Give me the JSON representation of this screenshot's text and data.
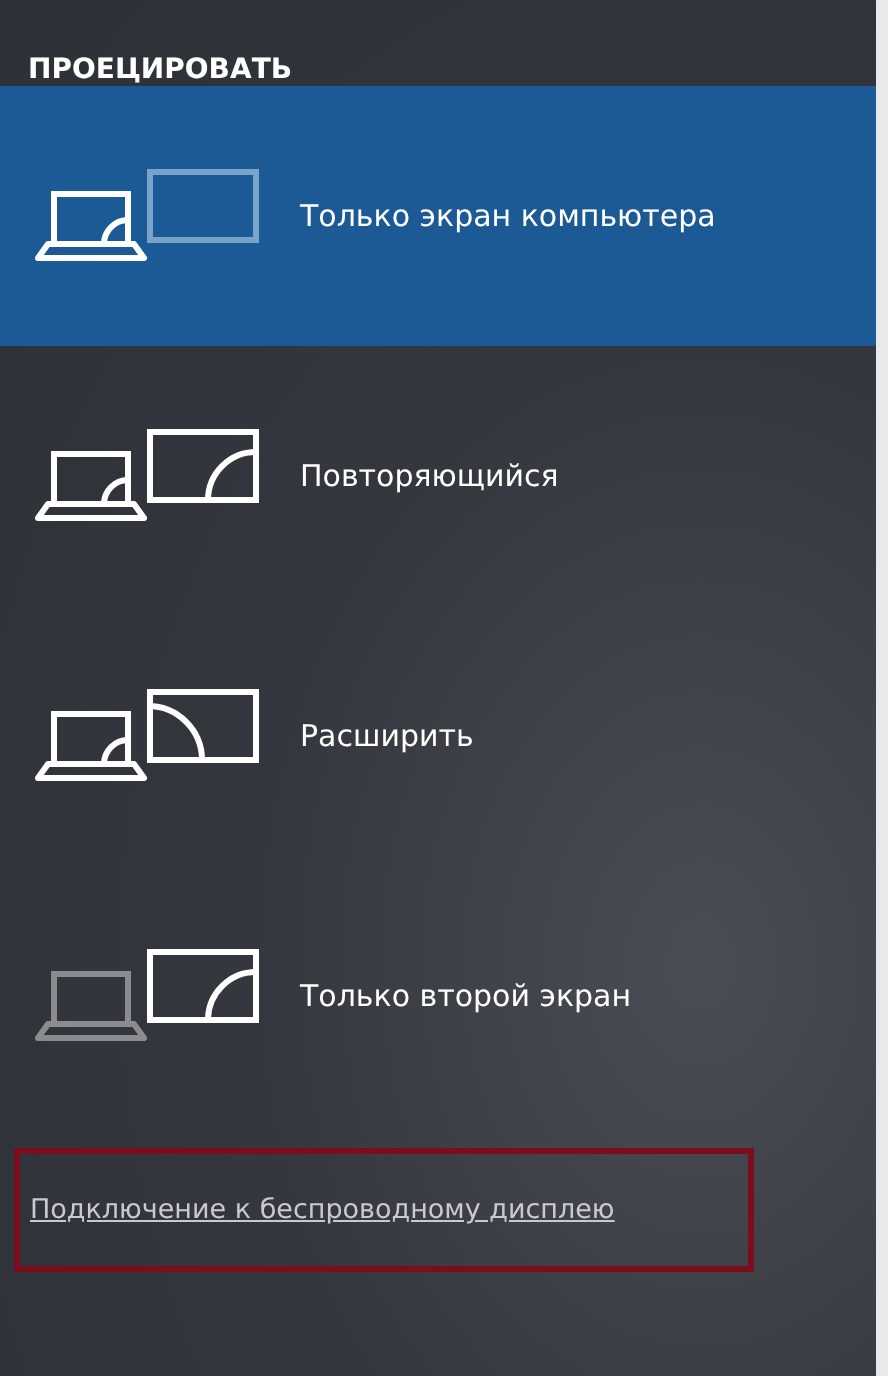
{
  "title": "ПРОЕЦИРОВАТЬ",
  "options": [
    {
      "kind": "pc_only",
      "label": "Только экран компьютера",
      "selected": true
    },
    {
      "kind": "duplicate",
      "label": "Повторяющийся",
      "selected": false
    },
    {
      "kind": "extend",
      "label": "Расширить",
      "selected": false
    },
    {
      "kind": "second_only",
      "label": "Только второй экран",
      "selected": false
    }
  ],
  "link": {
    "label": "Подключение к беспроводному дисплею",
    "highlighted": true
  }
}
